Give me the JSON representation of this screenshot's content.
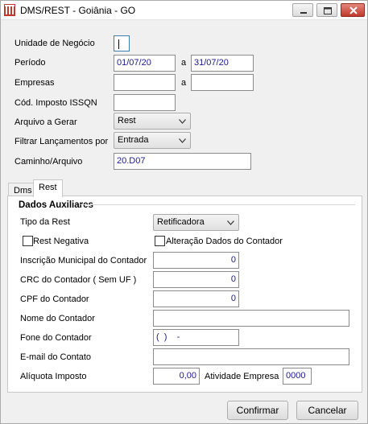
{
  "window": {
    "title": "DMS/REST - Goiânia - GO"
  },
  "form": {
    "unidade_label": "Unidade de Negócio",
    "unidade_value": "",
    "periodo_label": "Período",
    "periodo_start": "01/07/20",
    "periodo_sep": "a",
    "periodo_end": "31/07/20",
    "empresas_label": "Empresas",
    "empresas_start": "",
    "empresas_sep": "a",
    "empresas_end": "",
    "cod_label": "Cód. Imposto ISSQN",
    "cod_value": "",
    "arquivo_label": "Arquivo a Gerar",
    "arquivo_value": "Rest",
    "filtrar_label": "Filtrar Lançamentos por",
    "filtrar_value": "Entrada",
    "caminho_label": "Caminho/Arquivo",
    "caminho_value": "20.D07"
  },
  "tabs": [
    {
      "label": "Dms",
      "active": false
    },
    {
      "label": "Rest",
      "active": true
    }
  ],
  "rest": {
    "group_title": "Dados Auxiliares",
    "tipo_label": "Tipo da Rest",
    "tipo_value": "Retificadora",
    "rest_negativa_label": "Rest Negativa",
    "rest_negativa_checked": false,
    "alteracao_label": "Alteração Dados do Contador",
    "alteracao_checked": false,
    "inscricao_label": "Inscrição Municipal do Contador",
    "inscricao_value": "0",
    "crc_label": "CRC do Contador ( Sem UF )",
    "crc_value": "0",
    "cpf_label": "CPF do Contador",
    "cpf_value": "0",
    "nome_label": "Nome do Contador",
    "nome_value": "",
    "fone_label": "Fone do Contador",
    "fone_value": "(  )    -",
    "email_label": "E-mail do Contato",
    "email_value": "",
    "aliquota_label": "Alíquota Imposto",
    "aliquota_value": "0,00",
    "atividade_label": "Atividade Empresa",
    "atividade_value": "0000"
  },
  "buttons": {
    "confirmar": "Confirmar",
    "cancelar": "Cancelar"
  },
  "colors": {
    "field_text": "#1a1a8c",
    "close_button": "#c0392b"
  }
}
